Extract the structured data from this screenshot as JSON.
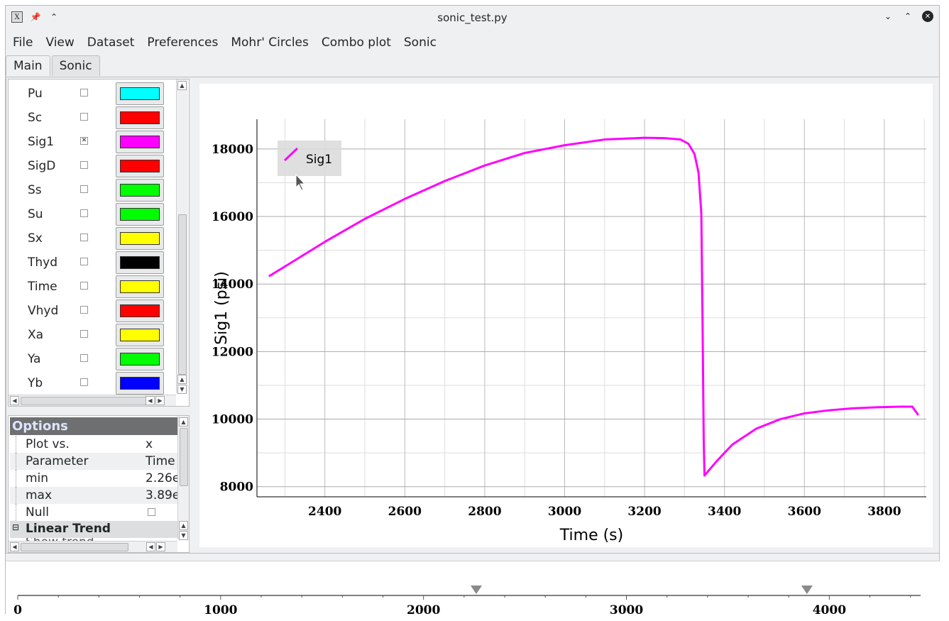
{
  "window": {
    "title": "sonic_test.py",
    "app_icon": "x-app-icon",
    "controls": [
      "minimize-icon",
      "maximize-icon",
      "close-icon"
    ]
  },
  "menu": [
    "File",
    "View",
    "Dataset",
    "Preferences",
    "Mohr' Circles",
    "Combo plot",
    "Sonic"
  ],
  "tabs": [
    {
      "label": "Main",
      "active": true
    },
    {
      "label": "Sonic",
      "active": false
    }
  ],
  "parameters": [
    {
      "name": "Pu",
      "checked": false,
      "color": "#00ffff"
    },
    {
      "name": "Sc",
      "checked": false,
      "color": "#ff0000"
    },
    {
      "name": "Sig1",
      "checked": true,
      "color": "#ff00ff"
    },
    {
      "name": "SigD",
      "checked": false,
      "color": "#ff0000"
    },
    {
      "name": "Ss",
      "checked": false,
      "color": "#00ff00"
    },
    {
      "name": "Su",
      "checked": false,
      "color": "#00ff00"
    },
    {
      "name": "Sx",
      "checked": false,
      "color": "#ffff00"
    },
    {
      "name": "Thyd",
      "checked": false,
      "color": "#000000"
    },
    {
      "name": "Time",
      "checked": false,
      "color": "#ffff00"
    },
    {
      "name": "Vhyd",
      "checked": false,
      "color": "#ff0000"
    },
    {
      "name": "Xa",
      "checked": false,
      "color": "#ffff00"
    },
    {
      "name": "Ya",
      "checked": false,
      "color": "#00ff00"
    },
    {
      "name": "Yb",
      "checked": false,
      "color": "#0000ff"
    }
  ],
  "options": {
    "header": "Options",
    "rows": [
      {
        "key": "Plot vs.",
        "value": "x"
      },
      {
        "key": "Parameter",
        "value": "Time"
      },
      {
        "key": "min",
        "value": "2.26e"
      },
      {
        "key": "max",
        "value": "3.89e"
      },
      {
        "key": "Null",
        "value": ""
      }
    ],
    "section": "Linear Trend",
    "section_toggle": "⊟",
    "partial_row": "Show trend"
  },
  "chart_data": {
    "type": "line",
    "xlabel": "Time (s)",
    "ylabel": "Sig1 (psi)",
    "xlim": [
      2230,
      3905
    ],
    "ylim": [
      7700,
      18880
    ],
    "xticks": [
      2400,
      2600,
      2800,
      3000,
      3200,
      3400,
      3600,
      3800
    ],
    "yticks": [
      8000,
      10000,
      12000,
      14000,
      16000,
      18000
    ],
    "ytick_labels": [
      "8000",
      "10000",
      "12000",
      "14000",
      "16000",
      "18000"
    ],
    "grid": true,
    "legend_position": "top-left",
    "series": [
      {
        "name": "Sig1",
        "color": "#ff00ff",
        "x": [
          2260,
          2300,
          2400,
          2500,
          2600,
          2700,
          2800,
          2900,
          3000,
          3100,
          3200,
          3250,
          3290,
          3310,
          3325,
          3335,
          3342,
          3345,
          3348,
          3350,
          3380,
          3420,
          3480,
          3540,
          3600,
          3660,
          3720,
          3780,
          3840,
          3870,
          3885
        ],
        "y": [
          14230,
          14520,
          15250,
          15930,
          16520,
          17050,
          17510,
          17880,
          18110,
          18280,
          18330,
          18320,
          18280,
          18150,
          17850,
          17300,
          16100,
          13000,
          9400,
          8330,
          8750,
          9250,
          9720,
          10000,
          10170,
          10260,
          10320,
          10350,
          10370,
          10370,
          10120
        ]
      }
    ]
  },
  "overview_axis": {
    "xlim": [
      0,
      4450
    ],
    "ticks": [
      0,
      1000,
      2000,
      3000,
      4000
    ],
    "markers": [
      2260,
      3890
    ]
  }
}
